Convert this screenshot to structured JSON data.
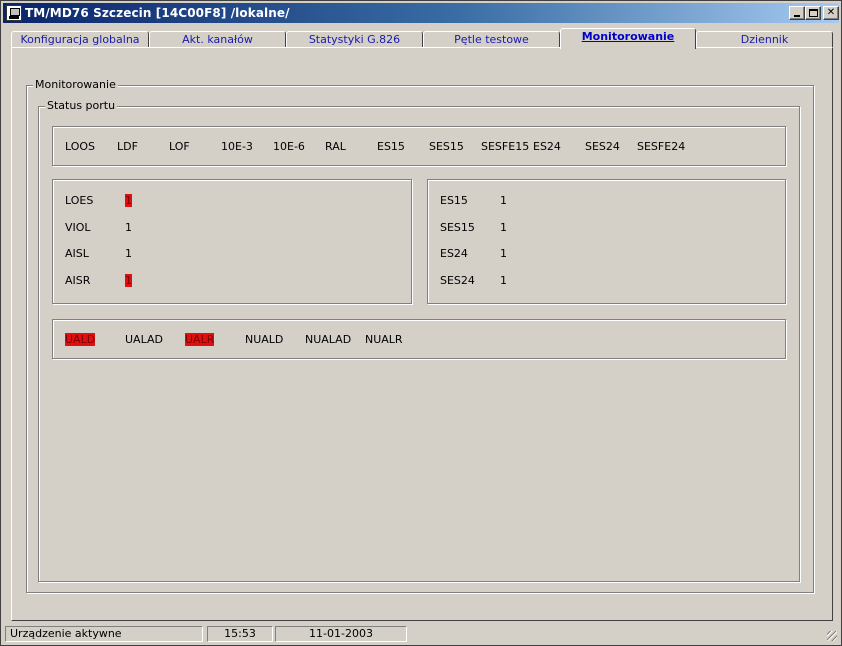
{
  "window": {
    "title": "TM/MD76 Szczecin [14C00F8] /lokalne/"
  },
  "tabs": [
    {
      "label": "Konfiguracja globalna"
    },
    {
      "label": "Akt. kanałów"
    },
    {
      "label": "Statystyki G.826"
    },
    {
      "label": "Pętle testowe"
    },
    {
      "label": "Monitorowanie"
    },
    {
      "label": "Dziennik"
    }
  ],
  "active_tab": "Monitorowanie",
  "monitor": {
    "group_label": "Monitorowanie",
    "port_group_label": "Status portu",
    "top_indicators": [
      {
        "label": "LOOS"
      },
      {
        "label": "LDF"
      },
      {
        "label": "LOF"
      },
      {
        "label": "10E-3"
      },
      {
        "label": "10E-6"
      },
      {
        "label": "RAL"
      },
      {
        "label": "ES15"
      },
      {
        "label": "SES15"
      },
      {
        "label": "SESFE15"
      },
      {
        "label": "ES24"
      },
      {
        "label": "SES24"
      },
      {
        "label": "SESFE24"
      }
    ],
    "left_rows": [
      {
        "label": "LOES",
        "value": "1",
        "alarm": true
      },
      {
        "label": "VIOL",
        "value": "1",
        "alarm": false
      },
      {
        "label": "AISL",
        "value": "1",
        "alarm": false
      },
      {
        "label": "AISR",
        "value": "1",
        "alarm": true
      }
    ],
    "right_rows": [
      {
        "label": "ES15",
        "value": "1"
      },
      {
        "label": "SES15",
        "value": "1"
      },
      {
        "label": "ES24",
        "value": "1"
      },
      {
        "label": "SES24",
        "value": "1"
      }
    ],
    "bottom_indicators": [
      {
        "label": "UALD",
        "alarm": true
      },
      {
        "label": "UALAD",
        "alarm": false
      },
      {
        "label": "UALR",
        "alarm": true
      },
      {
        "label": "NUALD",
        "alarm": false
      },
      {
        "label": "NUALAD",
        "alarm": false
      },
      {
        "label": "NUALR",
        "alarm": false
      }
    ]
  },
  "statusbar": {
    "status": "Urządzenie aktywne",
    "time": "15:53",
    "date": "11-01-2003"
  },
  "colors": {
    "alarm": "#e01010",
    "titlebar": "#0a246a",
    "tab_text": "#1a1aa8"
  }
}
